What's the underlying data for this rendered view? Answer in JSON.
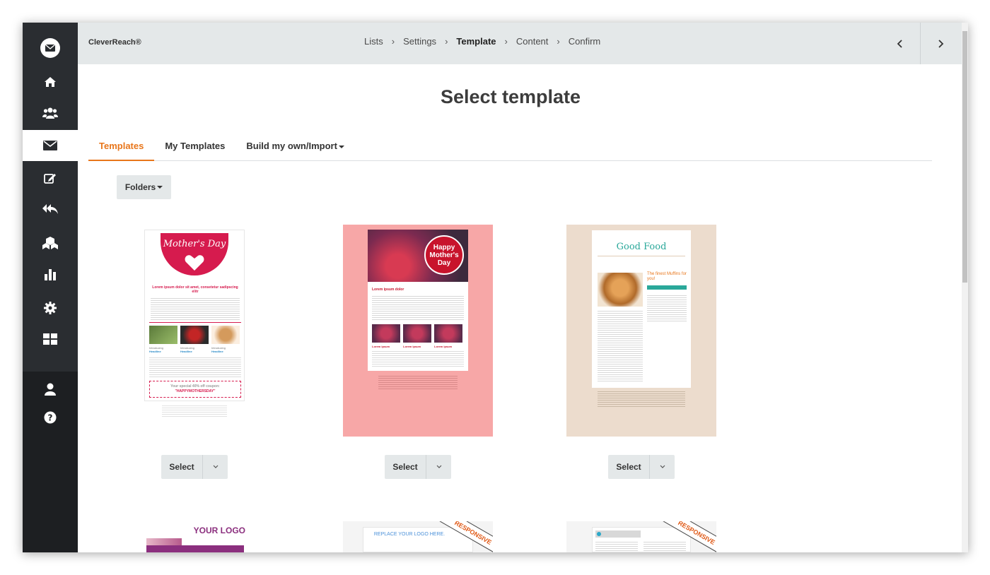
{
  "app": {
    "brand": "CleverReach®"
  },
  "breadcrumb": [
    {
      "label": "Lists",
      "active": false
    },
    {
      "label": "Settings",
      "active": false
    },
    {
      "label": "Template",
      "active": true
    },
    {
      "label": "Content",
      "active": false
    },
    {
      "label": "Confirm",
      "active": false
    }
  ],
  "nav": {
    "prev_icon": "chevron-left-icon",
    "next_icon": "chevron-right-icon"
  },
  "sidebar": {
    "items": [
      {
        "icon": "envelope-logo-icon"
      },
      {
        "icon": "home-icon"
      },
      {
        "icon": "users-icon"
      },
      {
        "icon": "envelope-icon",
        "active": true
      },
      {
        "icon": "edit-icon"
      },
      {
        "icon": "reply-all-icon"
      },
      {
        "icon": "cubes-icon"
      },
      {
        "icon": "bar-chart-icon"
      },
      {
        "icon": "gear-icon"
      },
      {
        "icon": "grid-icon"
      },
      {
        "icon": "user-icon"
      },
      {
        "icon": "help-icon"
      }
    ]
  },
  "page": {
    "title": "Select template"
  },
  "tabs": [
    {
      "label": "Templates",
      "active": true
    },
    {
      "label": "My Templates",
      "active": false
    },
    {
      "label": "Build my own/Import",
      "active": false,
      "dropdown": true
    }
  ],
  "folders": {
    "label": "Folders"
  },
  "templates": [
    {
      "select_label": "Select",
      "preview": {
        "banner": "Mother's Day",
        "headline": "Lorem ipsum dolor sit amet, consetetur sadipscing elitr",
        "coupon_line": "Your special 40% off coupon:",
        "coupon_code": "\"HAPPYMOTHERSDAY\"",
        "col_label": "Introducing",
        "col_headline": "Headline"
      }
    },
    {
      "select_label": "Select",
      "preview": {
        "banner": "Happy Mother's Day",
        "headline": "Lorem ipsum dolor",
        "col_label": "Lorem ipsum"
      }
    },
    {
      "select_label": "Select",
      "preview": {
        "banner": "Good Food",
        "headline": "The finest Muffins for you!"
      }
    },
    {
      "preview": {
        "banner": "YOUR LOGO"
      }
    },
    {
      "preview": {
        "banner": "REPLACE YOUR LOGO HERE.",
        "badge": "RESPONSIVE"
      }
    },
    {
      "preview": {
        "badge": "RESPONSIVE"
      }
    }
  ],
  "colors": {
    "accent": "#e8761b",
    "sidebar": "#2a2d31",
    "topbar": "#e4e8e9"
  }
}
